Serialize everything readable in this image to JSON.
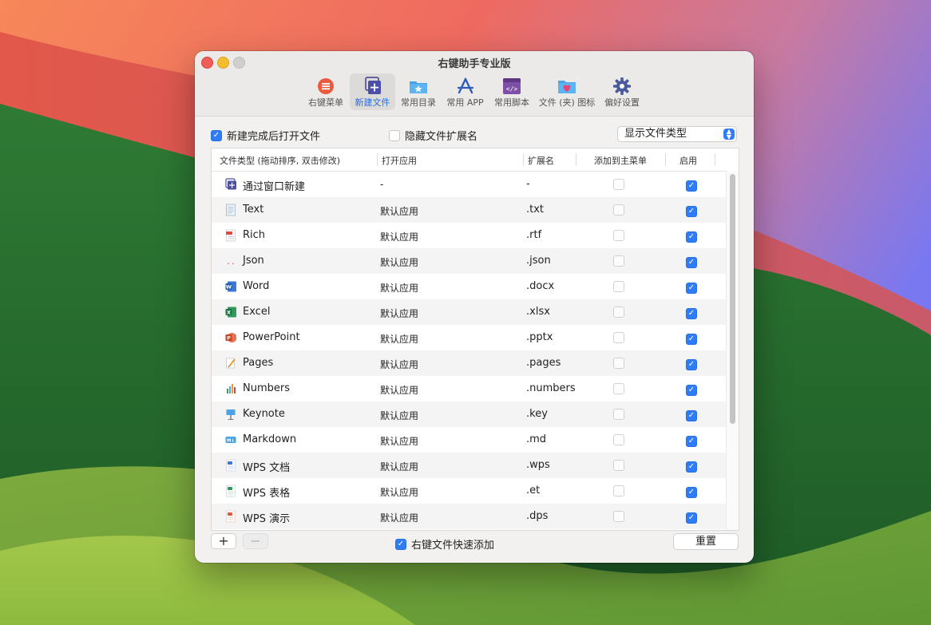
{
  "window": {
    "title": "右键助手专业版"
  },
  "toolbar": [
    {
      "label": "右键菜单",
      "icon": "menu-list-icon",
      "active": false
    },
    {
      "label": "新建文件",
      "icon": "new-file-icon",
      "active": true
    },
    {
      "label": "常用目录",
      "icon": "folder-star-icon",
      "active": false
    },
    {
      "label": "常用 APP",
      "icon": "app-store-icon",
      "active": false
    },
    {
      "label": "常用脚本",
      "icon": "script-icon",
      "active": false
    },
    {
      "label": "文件 (夹) 图标",
      "icon": "folder-heart-icon",
      "active": false
    },
    {
      "label": "偏好设置",
      "icon": "gear-icon",
      "active": false
    }
  ],
  "options": {
    "open_after_create": {
      "label": "新建完成后打开文件",
      "checked": true
    },
    "hide_extension": {
      "label": "隐藏文件扩展名",
      "checked": false
    },
    "display_select": {
      "value": "显示文件类型"
    }
  },
  "table": {
    "columns": [
      "文件类型 (拖动排序, 双击修改)",
      "打开应用",
      "扩展名",
      "添加到主菜单",
      "启用"
    ],
    "rows": [
      {
        "name": "通过窗口新建",
        "app": "-",
        "ext": "-",
        "icon": "new-window-icon",
        "main_menu": false,
        "enabled": true
      },
      {
        "name": "Text",
        "app": "默认应用",
        "ext": ".txt",
        "icon": "text-file-icon",
        "main_menu": false,
        "enabled": true
      },
      {
        "name": "Rich",
        "app": "默认应用",
        "ext": ".rtf",
        "icon": "rtf-file-icon",
        "main_menu": false,
        "enabled": true
      },
      {
        "name": "Json",
        "app": "默认应用",
        "ext": ".json",
        "icon": "json-file-icon",
        "main_menu": false,
        "enabled": true
      },
      {
        "name": "Word",
        "app": "默认应用",
        "ext": ".docx",
        "icon": "word-icon",
        "main_menu": false,
        "enabled": true
      },
      {
        "name": "Excel",
        "app": "默认应用",
        "ext": ".xlsx",
        "icon": "excel-icon",
        "main_menu": false,
        "enabled": true
      },
      {
        "name": "PowerPoint",
        "app": "默认应用",
        "ext": ".pptx",
        "icon": "powerpoint-icon",
        "main_menu": false,
        "enabled": true
      },
      {
        "name": "Pages",
        "app": "默认应用",
        "ext": ".pages",
        "icon": "pages-icon",
        "main_menu": false,
        "enabled": true
      },
      {
        "name": "Numbers",
        "app": "默认应用",
        "ext": ".numbers",
        "icon": "numbers-icon",
        "main_menu": false,
        "enabled": true
      },
      {
        "name": "Keynote",
        "app": "默认应用",
        "ext": ".key",
        "icon": "keynote-icon",
        "main_menu": false,
        "enabled": true
      },
      {
        "name": "Markdown",
        "app": "默认应用",
        "ext": ".md",
        "icon": "markdown-icon",
        "main_menu": false,
        "enabled": true
      },
      {
        "name": "WPS 文档",
        "app": "默认应用",
        "ext": ".wps",
        "icon": "wps-doc-icon",
        "main_menu": false,
        "enabled": true
      },
      {
        "name": "WPS 表格",
        "app": "默认应用",
        "ext": ".et",
        "icon": "wps-sheet-icon",
        "main_menu": false,
        "enabled": true
      },
      {
        "name": "WPS 演示",
        "app": "默认应用",
        "ext": ".dps",
        "icon": "wps-slide-icon",
        "main_menu": false,
        "enabled": true
      }
    ]
  },
  "bottom": {
    "add_label": "+",
    "remove_label": "−",
    "quick_add": {
      "label": "右键文件快速添加",
      "checked": true
    },
    "reset_label": "重置"
  },
  "colors": {
    "accent": "#2f7cf6"
  }
}
